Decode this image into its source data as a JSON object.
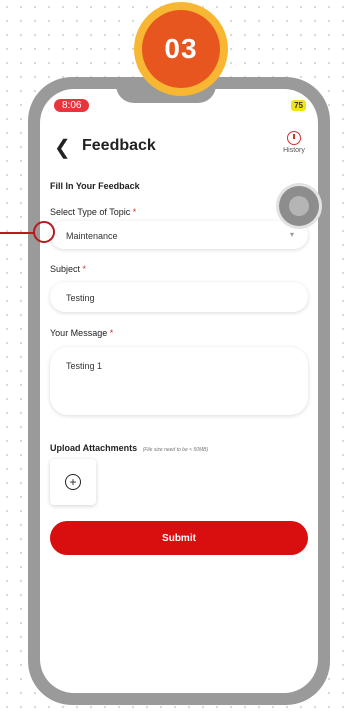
{
  "step": {
    "number": "03"
  },
  "status_bar": {
    "time": "8:06",
    "battery": "75"
  },
  "header": {
    "back_icon": "chevron-left-icon",
    "title": "Feedback",
    "history_label": "History",
    "history_icon": "clock-history-icon"
  },
  "form": {
    "section_title": "Fill In Your Feedback",
    "topic": {
      "label": "Select Type of Topic",
      "value": "Maintenance"
    },
    "subject": {
      "label": "Subject",
      "value": "Testing"
    },
    "message": {
      "label": "Your Message",
      "value": "Testing 1"
    },
    "required_marker": "*",
    "upload": {
      "label": "Upload Attachments",
      "note": "(File size need to be < 50MB)",
      "icon": "plus-circle-icon"
    },
    "submit_label": "Submit"
  },
  "colors": {
    "accent": "#d90f0f",
    "badge_outer": "#f7b733",
    "badge_inner": "#e8561f",
    "phone_frame": "#9a9a9a"
  }
}
